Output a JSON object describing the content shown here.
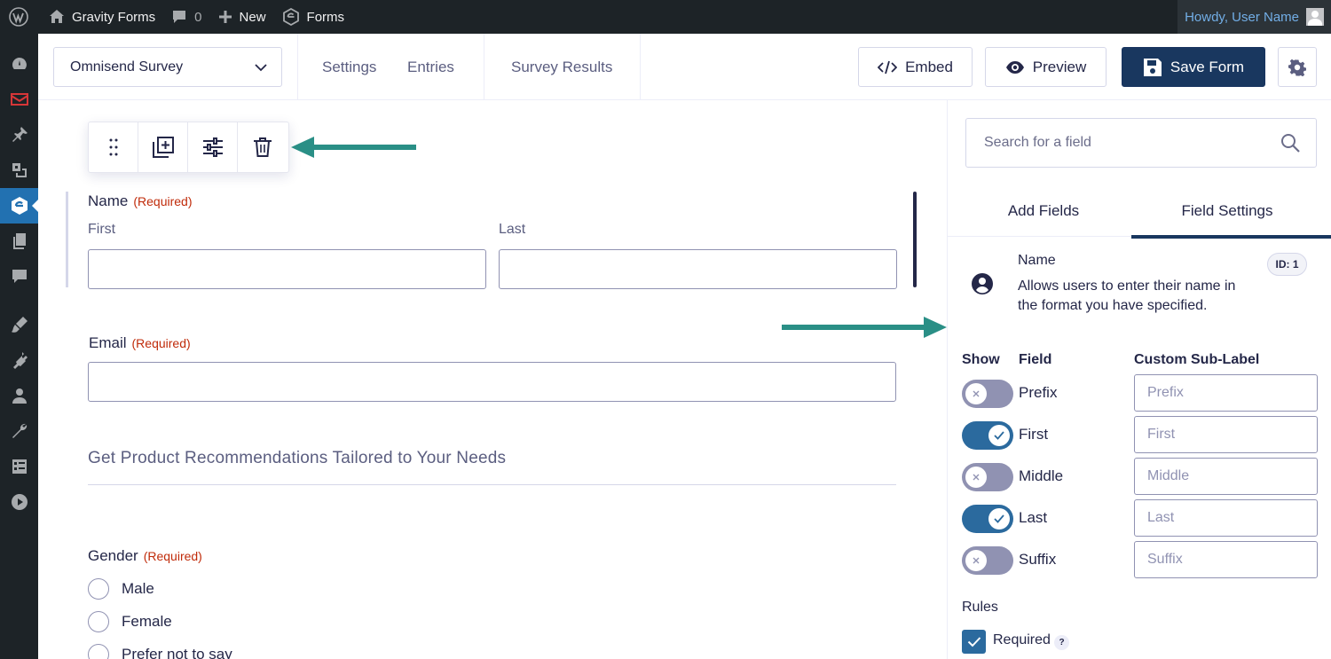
{
  "admin_bar": {
    "site_name": "Gravity Forms",
    "comments_count": "0",
    "new_label": "New",
    "forms_label": "Forms",
    "howdy": "Howdy, User Name"
  },
  "left_menu": {
    "items": [
      "dashboard-icon",
      "mail-icon",
      "pin-icon",
      "media-icon",
      "gravity-forms-icon",
      "pages-icon",
      "comments-icon",
      "appearance-icon",
      "plugins-icon",
      "users-icon",
      "tools-icon",
      "settings-icon",
      "play-icon"
    ],
    "active": "gravity-forms-icon"
  },
  "toolbar": {
    "form_name": "Omnisend Survey",
    "links": {
      "settings": "Settings",
      "entries": "Entries",
      "survey_results": "Survey Results"
    },
    "embed_label": "Embed",
    "preview_label": "Preview",
    "save_label": "Save Form"
  },
  "canvas": {
    "name_field": {
      "label": "Name",
      "required": "(Required)",
      "first": "First",
      "last": "Last"
    },
    "email_field": {
      "label": "Email",
      "required": "(Required)"
    },
    "section_title": "Get Product Recommendations Tailored to Your Needs",
    "gender_field": {
      "label": "Gender",
      "required": "(Required)",
      "options": [
        "Male",
        "Female",
        "Prefer not to say"
      ]
    },
    "annotation_color": "#2a8f86"
  },
  "sidebar": {
    "search_placeholder": "Search for a field",
    "tabs": {
      "add_fields": "Add Fields",
      "field_settings": "Field Settings"
    },
    "field_info": {
      "title": "Name",
      "description": "Allows users to enter their name in the format you have specified.",
      "id": "ID: 1"
    },
    "columns": {
      "show": "Show",
      "field": "Field",
      "custom": "Custom Sub-Label"
    },
    "subfields": [
      {
        "name": "Prefix",
        "placeholder": "Prefix",
        "shown": false
      },
      {
        "name": "First",
        "placeholder": "First",
        "shown": true
      },
      {
        "name": "Middle",
        "placeholder": "Middle",
        "shown": false
      },
      {
        "name": "Last",
        "placeholder": "Last",
        "shown": true
      },
      {
        "name": "Suffix",
        "placeholder": "Suffix",
        "shown": false
      }
    ],
    "rules_label": "Rules",
    "required_label": "Required",
    "required_checked": true,
    "help": "?"
  }
}
